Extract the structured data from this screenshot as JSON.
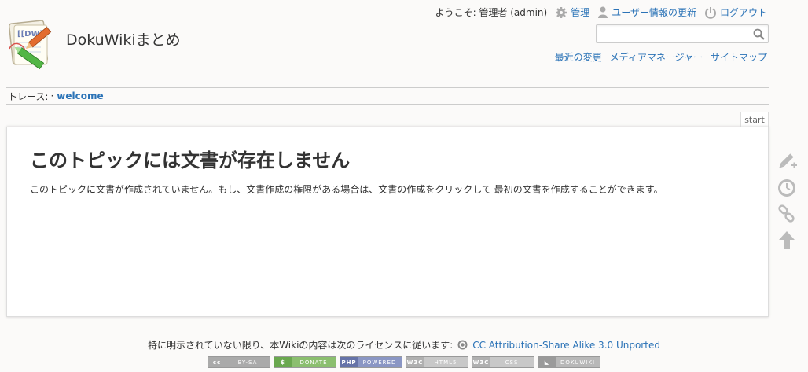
{
  "header": {
    "site_title": "DokuWikiまとめ",
    "welcome": "ようこそ: 管理者 (admin)",
    "admin": "管理",
    "profile": "ユーザー情報の更新",
    "logout": "ログアウト",
    "logo_text": "[[DW]]"
  },
  "search": {
    "value": "",
    "placeholder": ""
  },
  "site_tools": {
    "recent": "最近の変更",
    "media": "メディアマネージャー",
    "sitemap": "サイトマップ"
  },
  "breadcrumbs": {
    "label": "トレース:",
    "separator": "·",
    "items": [
      "welcome"
    ]
  },
  "page": {
    "id": "start",
    "heading": "このトピックには文書が存在しません",
    "text": "このトピックに文書が作成されていません。もし、文書作成の権限がある場合は、文書の作成をクリックして 最初の文書を作成することができます。"
  },
  "page_tools": [
    "create-page-icon",
    "old-revisions-icon",
    "backlinks-icon",
    "back-to-top-icon"
  ],
  "footer": {
    "license_text": "特に明示されていない限り、本Wikiの内容は次のライセンスに従います:",
    "license_link": "CC Attribution-Share Alike 3.0 Unported",
    "badges": [
      {
        "left": "cc",
        "right": "BY-SA",
        "lcolor": "#aaaaaa",
        "rcolor": "#aaaaaa"
      },
      {
        "left": "$",
        "right": "DONATE",
        "lcolor": "#6aa84f",
        "rcolor": "#8bbf6f"
      },
      {
        "left": "PHP",
        "right": "POWERED",
        "lcolor": "#6673a8",
        "rcolor": "#8a96c4"
      },
      {
        "left": "W3C",
        "right": "HTML5",
        "lcolor": "#b0b0b0",
        "rcolor": "#c8c8c8"
      },
      {
        "left": "W3C",
        "right": "CSS",
        "lcolor": "#b0b0b0",
        "rcolor": "#c8c8c8"
      },
      {
        "left": "◣",
        "right": "DOKUWIKI",
        "lcolor": "#9a9a9a",
        "rcolor": "#b8b8b8"
      }
    ]
  },
  "colors": {
    "link": "#2b73b7",
    "text": "#333333",
    "background": "#fbfaf9"
  }
}
